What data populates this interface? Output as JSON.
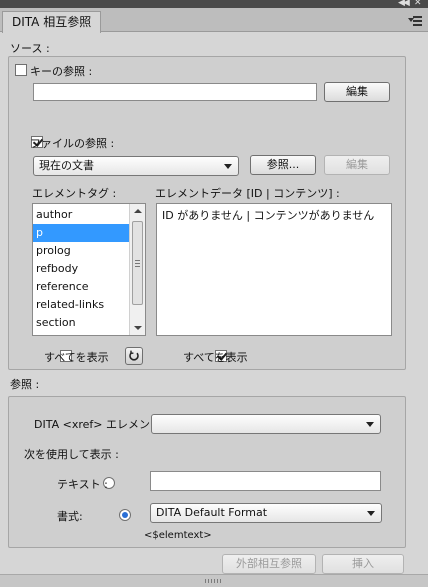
{
  "panel": {
    "tab_title": "DITA 相互参照"
  },
  "source": {
    "label": "ソース :",
    "key_ref": {
      "label": "キーの参照 :",
      "checked": false,
      "value": "",
      "edit_label": "編集"
    },
    "file_ref": {
      "label": "ファイルの参照 :",
      "checked": true,
      "selected": "現在の文書",
      "browse_label": "参照...",
      "edit_label": "編集"
    },
    "element_tag": {
      "label": "エレメントタグ :",
      "items": [
        "author",
        "p",
        "prolog",
        "refbody",
        "reference",
        "related-links",
        "section"
      ],
      "selected_index": 1,
      "show_all_label": "すべてを表示"
    },
    "element_data": {
      "label": "エレメントデータ [ID | コンテンツ] :",
      "items": [
        "ID がありません | コンテンツがありません"
      ],
      "show_all_label": "すべてを表示",
      "show_all_checked": true
    }
  },
  "reference": {
    "label": "参照 :",
    "xref_element_label": "DITA <xref> エレメント :",
    "xref_element_value": "",
    "display_label": "次を使用して表示 :",
    "text_option_label": "テキスト :",
    "text_value": "",
    "format_option_label": "書式:",
    "format_value": "DITA Default Format",
    "format_hint": "<$elemtext>"
  },
  "actions": {
    "external_label": "外部相互参照",
    "insert_label": "挿入"
  }
}
